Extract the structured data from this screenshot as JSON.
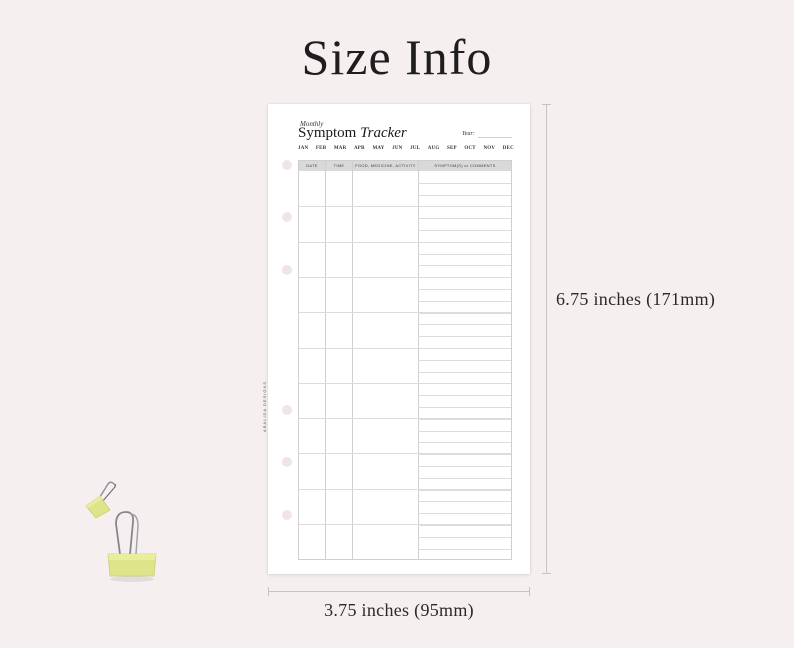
{
  "heading": "Size Info",
  "page": {
    "monthly_label": "Monthly",
    "title_plain": "Symptom ",
    "title_italic": "Tracker",
    "year_label": "Year:",
    "months": [
      "JAN",
      "FEB",
      "MAR",
      "APR",
      "MAY",
      "JUN",
      "JUL",
      "AUG",
      "SEP",
      "OCT",
      "NOV",
      "DEC"
    ],
    "columns": [
      "DATE",
      "TIME",
      "FOOD, MEDICINE, ACTIVITY",
      "SYMPTOM(S) or COMMENTS"
    ],
    "brand": "ARALIDA DESIGNS"
  },
  "dimensions": {
    "height_label": "6.75 inches (171mm)",
    "width_label": "3.75 inches (95mm)"
  },
  "colors": {
    "background": "#f5eff0",
    "clip_yellow": "#dde48a",
    "header_gray": "#d9d9d9"
  }
}
